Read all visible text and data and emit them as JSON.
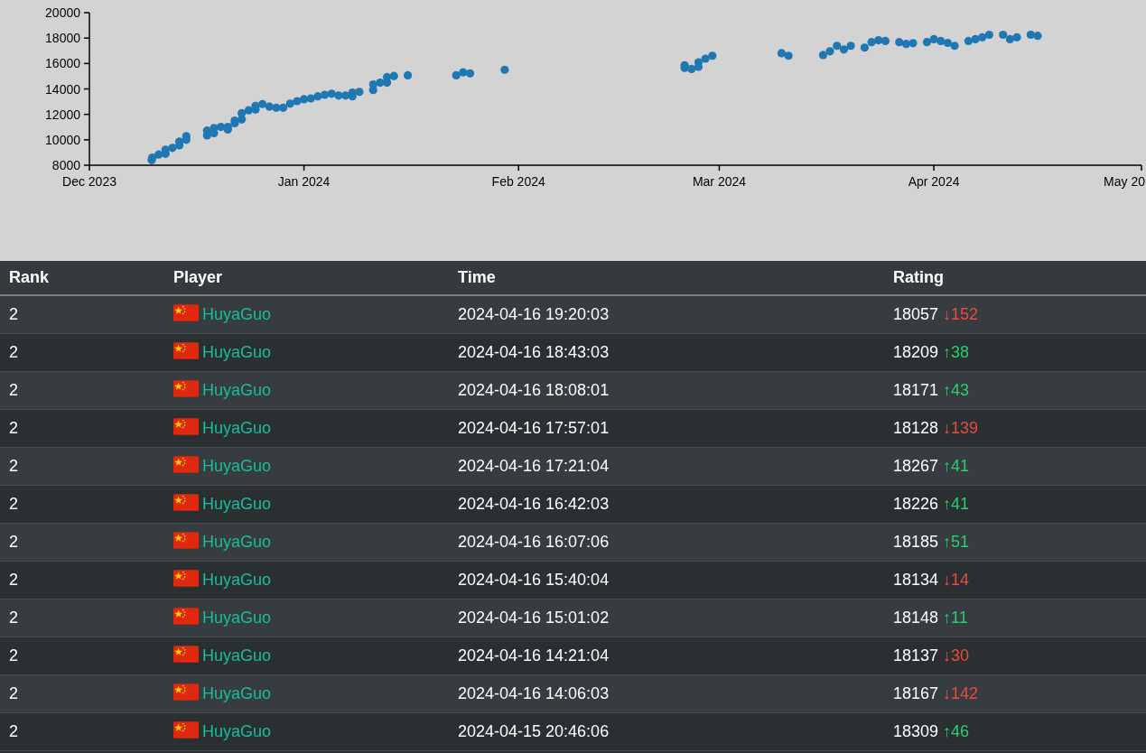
{
  "chart": {
    "chart_data": {
      "type": "scatter",
      "x": [
        "2023-12-10",
        "2023-12-10T02:00",
        "2023-12-11",
        "2023-12-12",
        "2023-12-12",
        "2023-12-13",
        "2023-12-14",
        "2023-12-14",
        "2023-12-15",
        "2023-12-15",
        "2023-12-18",
        "2023-12-18",
        "2023-12-19",
        "2023-12-19",
        "2023-12-20",
        "2023-12-21",
        "2023-12-21",
        "2023-12-22",
        "2023-12-22",
        "2023-12-23",
        "2023-12-23",
        "2023-12-24",
        "2023-12-25",
        "2023-12-25",
        "2023-12-26",
        "2023-12-27",
        "2023-12-28",
        "2023-12-29",
        "2023-12-30",
        "2023-12-31",
        "2024-01-01",
        "2024-01-02",
        "2024-01-03",
        "2024-01-04",
        "2024-01-05",
        "2024-01-06",
        "2024-01-07",
        "2024-01-08",
        "2024-01-08",
        "2024-01-09",
        "2024-01-11",
        "2024-01-11",
        "2024-01-12",
        "2024-01-13",
        "2024-01-13",
        "2024-01-14",
        "2024-01-16",
        "2024-01-23",
        "2024-01-24",
        "2024-01-25",
        "2024-01-30",
        "2024-02-25",
        "2024-02-25",
        "2024-02-26",
        "2024-02-27",
        "2024-02-27",
        "2024-02-28",
        "2024-02-29",
        "2024-03-10",
        "2024-03-11",
        "2024-03-16",
        "2024-03-17",
        "2024-03-18",
        "2024-03-19",
        "2024-03-20",
        "2024-03-22",
        "2024-03-23",
        "2024-03-24",
        "2024-03-25",
        "2024-03-27",
        "2024-03-28",
        "2024-03-29",
        "2024-03-31",
        "2024-04-01",
        "2024-04-02",
        "2024-04-03",
        "2024-04-04",
        "2024-04-06",
        "2024-04-07",
        "2024-04-08",
        "2024-04-09",
        "2024-04-11",
        "2024-04-12",
        "2024-04-13",
        "2024-04-15",
        "2024-04-16"
      ],
      "series": [
        {
          "color": "#1f77b4",
          "values": [
            8400,
            8600,
            8840,
            8900,
            9220,
            9360,
            9570,
            9860,
            10000,
            10290,
            10350,
            10720,
            10520,
            10930,
            11010,
            10810,
            11010,
            11300,
            11510,
            11600,
            12090,
            12320,
            12380,
            12670,
            12810,
            12610,
            12520,
            12520,
            12840,
            13040,
            13190,
            13250,
            13420,
            13540,
            13620,
            13480,
            13480,
            13420,
            13710,
            13770,
            13910,
            14350,
            14490,
            14490,
            14930,
            15020,
            15070,
            15070,
            15310,
            15220,
            15510,
            15650,
            15860,
            15570,
            15740,
            16090,
            16380,
            16610,
            16810,
            16610,
            16670,
            16960,
            17390,
            17100,
            17390,
            17250,
            17680,
            17830,
            17770,
            17680,
            17540,
            17600,
            17680,
            17910,
            17770,
            17620,
            17390,
            17770,
            17910,
            18060,
            18260,
            18260,
            17910,
            18060,
            18260,
            18180
          ]
        }
      ],
      "xlim": [
        "2023-12-01",
        "2024-05-01"
      ],
      "ylim": [
        8000,
        20000
      ],
      "xticks": [
        {
          "value": "2023-12-01",
          "label": "Dec 2023"
        },
        {
          "value": "2024-01-01",
          "label": "Jan 2024"
        },
        {
          "value": "2024-02-01",
          "label": "Feb 2024"
        },
        {
          "value": "2024-03-01",
          "label": "Mar 2024"
        },
        {
          "value": "2024-04-01",
          "label": "Apr 2024"
        }
      ],
      "yticks": [
        8000,
        10000,
        12000,
        14000,
        16000,
        18000,
        20000
      ]
    },
    "axis_end_label": "May 20"
  },
  "table": {
    "columns": [
      "Rank",
      "Player",
      "Time",
      "Rating"
    ],
    "rows": [
      {
        "rank": "2",
        "player": "HuyaGuo",
        "time": "2024-04-16 19:20:03",
        "rating": "18057",
        "change": "↓152",
        "color": "#e74c3c"
      },
      {
        "rank": "2",
        "player": "HuyaGuo",
        "time": "2024-04-16 18:43:03",
        "rating": "18209",
        "change": "↑38",
        "color": "#2ecc71"
      },
      {
        "rank": "2",
        "player": "HuyaGuo",
        "time": "2024-04-16 18:08:01",
        "rating": "18171",
        "change": "↑43",
        "color": "#2ecc71"
      },
      {
        "rank": "2",
        "player": "HuyaGuo",
        "time": "2024-04-16 17:57:01",
        "rating": "18128",
        "change": "↓139",
        "color": "#e74c3c"
      },
      {
        "rank": "2",
        "player": "HuyaGuo",
        "time": "2024-04-16 17:21:04",
        "rating": "18267",
        "change": "↑41",
        "color": "#2ecc71"
      },
      {
        "rank": "2",
        "player": "HuyaGuo",
        "time": "2024-04-16 16:42:03",
        "rating": "18226",
        "change": "↑41",
        "color": "#2ecc71"
      },
      {
        "rank": "2",
        "player": "HuyaGuo",
        "time": "2024-04-16 16:07:06",
        "rating": "18185",
        "change": "↑51",
        "color": "#2ecc71"
      },
      {
        "rank": "2",
        "player": "HuyaGuo",
        "time": "2024-04-16 15:40:04",
        "rating": "18134",
        "change": "↓14",
        "color": "#e74c3c"
      },
      {
        "rank": "2",
        "player": "HuyaGuo",
        "time": "2024-04-16 15:01:02",
        "rating": "18148",
        "change": "↑11",
        "color": "#2ecc71"
      },
      {
        "rank": "2",
        "player": "HuyaGuo",
        "time": "2024-04-16 14:21:04",
        "rating": "18137",
        "change": "↓30",
        "color": "#e74c3c"
      },
      {
        "rank": "2",
        "player": "HuyaGuo",
        "time": "2024-04-16 14:06:03",
        "rating": "18167",
        "change": "↓142",
        "color": "#e74c3c"
      },
      {
        "rank": "2",
        "player": "HuyaGuo",
        "time": "2024-04-15 20:46:06",
        "rating": "18309",
        "change": "↑46",
        "color": "#2ecc71"
      }
    ]
  }
}
